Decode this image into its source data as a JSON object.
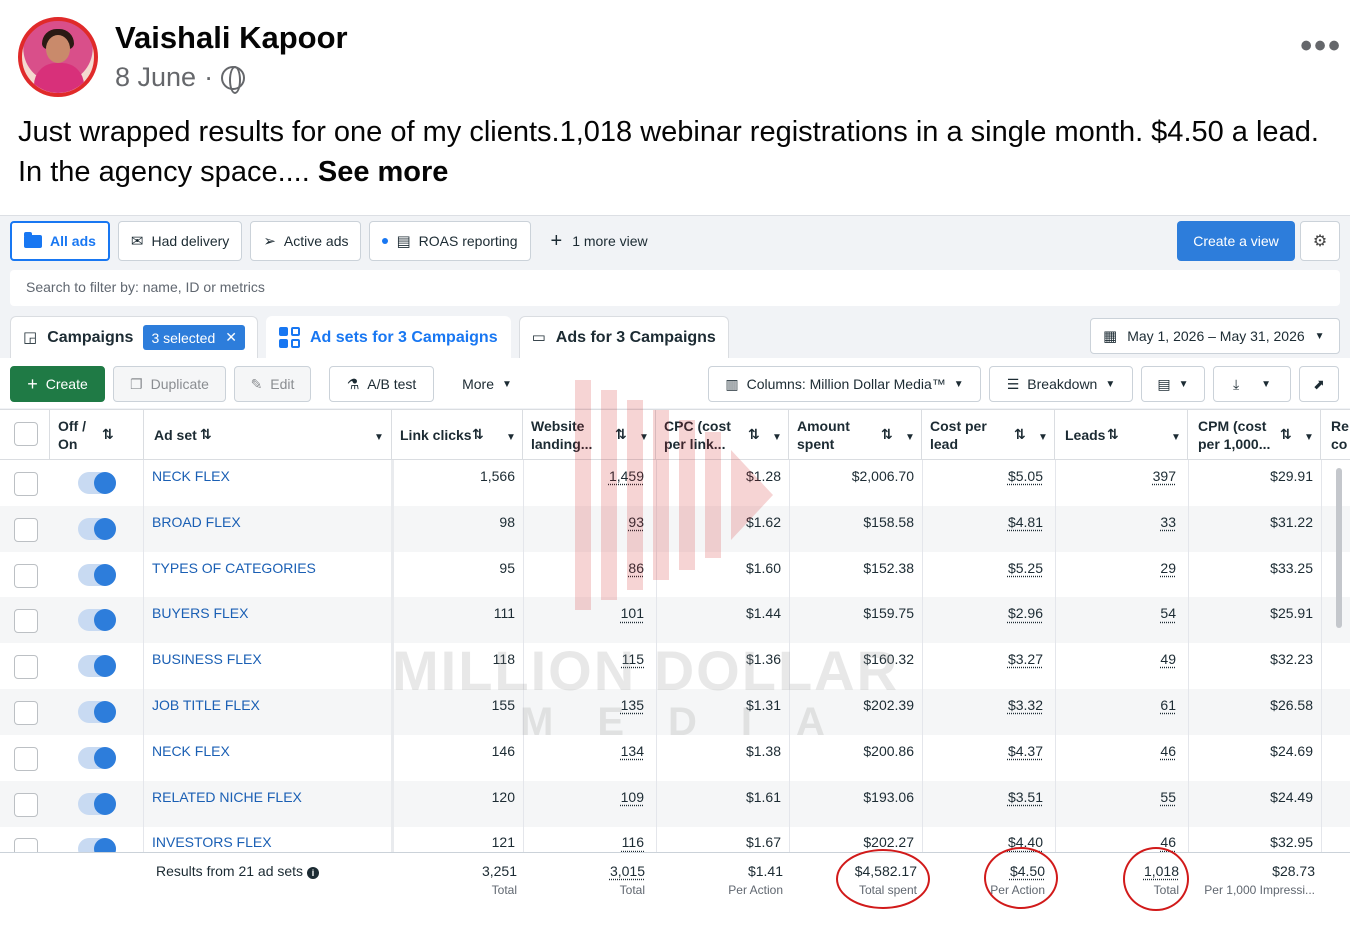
{
  "post": {
    "author": "Vaishali Kapoor",
    "date": "8 June",
    "separator": "·",
    "more": "•••",
    "text": "Just wrapped results for one of my clients.1,018 webinar registrations in a single month. $4.50 a lead. In the agency space.... ",
    "see_more": "See more"
  },
  "views": {
    "items": [
      {
        "label": "All ads",
        "icon": "folder-icon"
      },
      {
        "label": "Had delivery",
        "icon": "envelope-icon"
      },
      {
        "label": "Active ads",
        "icon": "send-icon"
      },
      {
        "label": "ROAS reporting",
        "icon": "document-icon"
      }
    ],
    "more_view": "1 more view",
    "create_view": "Create a view"
  },
  "search": {
    "placeholder": "Search to filter by: name, ID or metrics"
  },
  "levels": {
    "campaigns": "Campaigns",
    "selected": "3 selected",
    "adsets": "Ad sets for 3 Campaigns",
    "ads": "Ads for 3 Campaigns"
  },
  "date_range": "May 1, 2026 – May 31, 2026",
  "actions": {
    "create": "Create",
    "duplicate": "Duplicate",
    "edit": "Edit",
    "ab_test": "A/B test",
    "more": "More",
    "columns": "Columns: Million Dollar Media™",
    "breakdown": "Breakdown"
  },
  "table": {
    "headers": {
      "offon": "Off / On",
      "adset": "Ad set",
      "link_clicks": "Link clicks",
      "website_landing": "Website landing...",
      "cpc": "CPC (cost per link...",
      "amount": "Amount spent",
      "cost_per_lead": "Cost per lead",
      "leads": "Leads",
      "cpm": "CPM (cost per 1,000...",
      "re": "Re co"
    },
    "rows": [
      {
        "name": "NECK FLEX",
        "clicks": "1,566",
        "landing": "1,459",
        "cpc": "$1.28",
        "spent": "$2,006.70",
        "cpl": "$5.05",
        "leads": "397",
        "cpm": "$29.91"
      },
      {
        "name": "BROAD FLEX",
        "clicks": "98",
        "landing": "93",
        "cpc": "$1.62",
        "spent": "$158.58",
        "cpl": "$4.81",
        "leads": "33",
        "cpm": "$31.22"
      },
      {
        "name": "TYPES OF CATEGORIES",
        "clicks": "95",
        "landing": "86",
        "cpc": "$1.60",
        "spent": "$152.38",
        "cpl": "$5.25",
        "leads": "29",
        "cpm": "$33.25"
      },
      {
        "name": "BUYERS FLEX",
        "clicks": "111",
        "landing": "101",
        "cpc": "$1.44",
        "spent": "$159.75",
        "cpl": "$2.96",
        "leads": "54",
        "cpm": "$25.91"
      },
      {
        "name": "BUSINESS FLEX",
        "clicks": "118",
        "landing": "115",
        "cpc": "$1.36",
        "spent": "$160.32",
        "cpl": "$3.27",
        "leads": "49",
        "cpm": "$32.23"
      },
      {
        "name": "JOB TITLE FLEX",
        "clicks": "155",
        "landing": "135",
        "cpc": "$1.31",
        "spent": "$202.39",
        "cpl": "$3.32",
        "leads": "61",
        "cpm": "$26.58"
      },
      {
        "name": "NECK FLEX",
        "clicks": "146",
        "landing": "134",
        "cpc": "$1.38",
        "spent": "$200.86",
        "cpl": "$4.37",
        "leads": "46",
        "cpm": "$24.69"
      },
      {
        "name": "RELATED NICHE FLEX",
        "clicks": "120",
        "landing": "109",
        "cpc": "$1.61",
        "spent": "$193.06",
        "cpl": "$3.51",
        "leads": "55",
        "cpm": "$24.49"
      },
      {
        "name": "INVESTORS FLEX",
        "clicks": "121",
        "landing": "116",
        "cpc": "$1.67",
        "spent": "$202.27",
        "cpl": "$4.40",
        "leads": "46",
        "cpm": "$32.95"
      }
    ],
    "footer": {
      "label": "Results from 21 ad sets",
      "clicks": "3,251",
      "clicks_sub": "Total",
      "landing": "3,015",
      "landing_sub": "Total",
      "cpc": "$1.41",
      "cpc_sub": "Per Action",
      "spent": "$4,582.17",
      "spent_sub": "Total spent",
      "cpl": "$4.50",
      "cpl_sub": "Per Action",
      "leads": "1,018",
      "leads_sub": "Total",
      "cpm": "$28.73",
      "cpm_sub": "Per 1,000 Impressi..."
    }
  },
  "watermark": {
    "line1": "MILLION DOLLAR",
    "line2": "MEDIA"
  },
  "colors": {
    "accent": "#1877f2",
    "create_green": "#1f7a45",
    "highlight": "#d11a1a"
  }
}
